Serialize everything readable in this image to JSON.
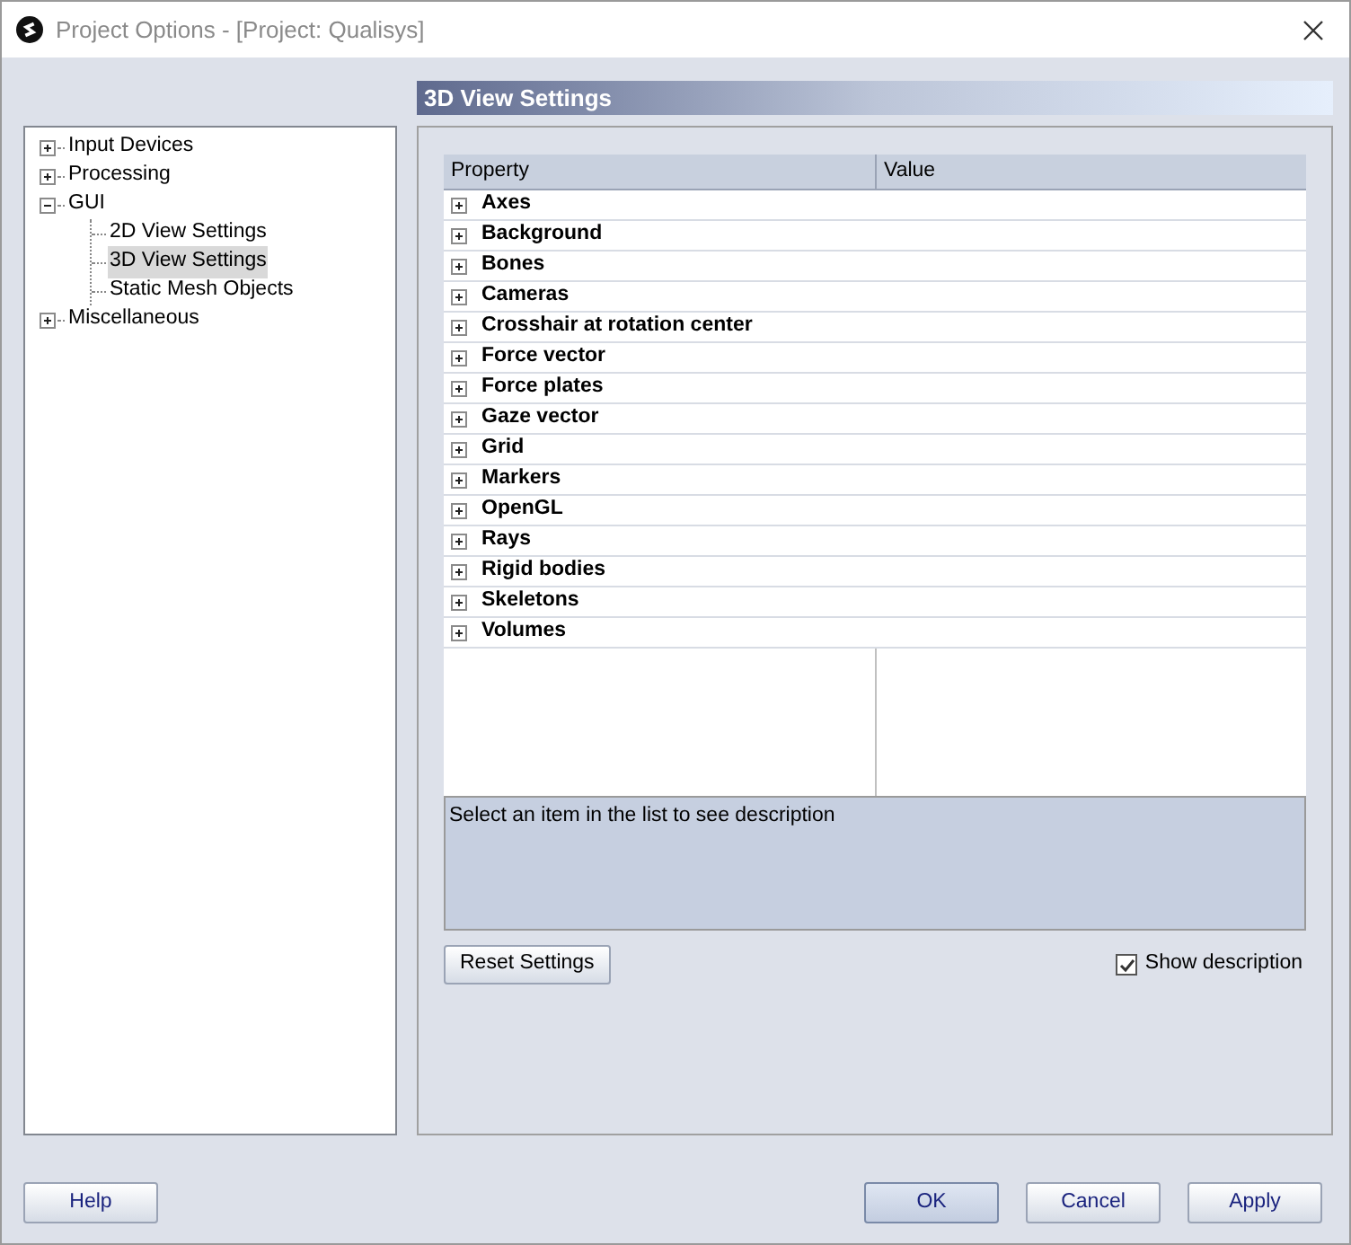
{
  "window": {
    "title": "Project Options - [Project: Qualisys]"
  },
  "tree": [
    {
      "label": "Input Devices",
      "expanded": false,
      "selected": false
    },
    {
      "label": "Processing",
      "expanded": false,
      "selected": false
    },
    {
      "label": "GUI",
      "expanded": true,
      "selected": false,
      "children": [
        {
          "label": "2D View Settings",
          "selected": false
        },
        {
          "label": "3D View Settings",
          "selected": true
        },
        {
          "label": "Static Mesh Objects",
          "selected": false
        }
      ]
    },
    {
      "label": "Miscellaneous",
      "expanded": false,
      "selected": false
    }
  ],
  "page_title": "3D View Settings",
  "grid": {
    "columns": [
      "Property",
      "Value"
    ],
    "rows": [
      {
        "label": "Axes",
        "expanded": false
      },
      {
        "label": "Background",
        "expanded": false
      },
      {
        "label": "Bones",
        "expanded": false
      },
      {
        "label": "Cameras",
        "expanded": false
      },
      {
        "label": "Crosshair at rotation center",
        "expanded": false
      },
      {
        "label": "Force vector",
        "expanded": false
      },
      {
        "label": "Force plates",
        "expanded": false
      },
      {
        "label": "Gaze vector",
        "expanded": false
      },
      {
        "label": "Grid",
        "expanded": false
      },
      {
        "label": "Markers",
        "expanded": false
      },
      {
        "label": "OpenGL",
        "expanded": false
      },
      {
        "label": "Rays",
        "expanded": false
      },
      {
        "label": "Rigid bodies",
        "expanded": false
      },
      {
        "label": "Skeletons",
        "expanded": false
      },
      {
        "label": "Volumes",
        "expanded": false
      }
    ]
  },
  "description": "Select an item in the list to see description",
  "reset_button": "Reset Settings",
  "show_description": {
    "label": "Show description",
    "checked": true
  },
  "buttons": [
    {
      "label": "Help",
      "default": false
    },
    {
      "label": "OK",
      "default": true
    },
    {
      "label": "Cancel",
      "default": false
    },
    {
      "label": "Apply",
      "default": false
    }
  ]
}
